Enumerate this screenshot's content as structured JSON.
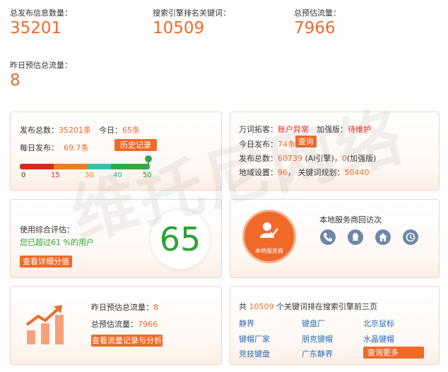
{
  "stats": {
    "published_label": "总发布信息数量：",
    "published_value": "35201",
    "keywords_label": "搜索引擎排名关键词：",
    "keywords_value": "10509",
    "traffic_label": "总预估流量：",
    "traffic_value": "7966",
    "yesterday_label": "昨日预估总流量：",
    "yesterday_value": "8"
  },
  "publish_card": {
    "total_label": "发布总数：",
    "total_value": "35201条",
    "today_label": "今日：",
    "today_value": "65条",
    "daily_label": "每日发布：",
    "daily_value": "69.7条",
    "history_button": "历史记录",
    "ticks": [
      "0",
      "15",
      "30",
      "40",
      "50"
    ],
    "progress_value": 50
  },
  "account_card": {
    "expand_label": "万词拓客：",
    "expand_status": "账户异常",
    "enhanced_label": "加强版：",
    "enhanced_status": "待维护",
    "today_pub_label": "今日发布：",
    "today_pub_value": "74条",
    "query_button": "查询",
    "total_label": "发布总数：",
    "total_value": "60739",
    "total_engine": "(AI引擎)",
    "total_sep": "，",
    "total_enhanced_value": "0",
    "total_enhanced": "(加强版)",
    "region_label": "地域设置：",
    "region_value": "96",
    "plan_label": "，  关键词规划：",
    "plan_value": "50440"
  },
  "score_card": {
    "label": "使用综合评估：",
    "beyond_text": "您已超过61 %的用户",
    "detail_button": "查看详细分值",
    "score": "65"
  },
  "service_card": {
    "logo_text": "本地服务商",
    "title": "本地服务商回访次",
    "icons": [
      "phone-icon",
      "qq-icon",
      "home-icon",
      "history-icon"
    ]
  },
  "traffic_card": {
    "yesterday_label": "昨日预估总流量：",
    "yesterday_value": "8",
    "total_label": "总预估流量：",
    "total_value": "7966",
    "button": "查看流量记录与分析"
  },
  "keyword_card": {
    "prefix": "共 ",
    "count": "10509",
    "suffix": " 个关键词排在搜索引擎前三页",
    "keywords": [
      "静界",
      "键盘厂",
      "北京鼠标",
      "键帽厂家",
      "朋克键帽",
      "水晶键帽",
      "竞技键盘",
      "广东静界"
    ],
    "more_button": "查询更多"
  },
  "watermark": "维托尼网络",
  "colors": {
    "accent": "#f06a2a",
    "good": "#2aa232",
    "bad": "#e8251c",
    "link": "#2b6bb8"
  }
}
